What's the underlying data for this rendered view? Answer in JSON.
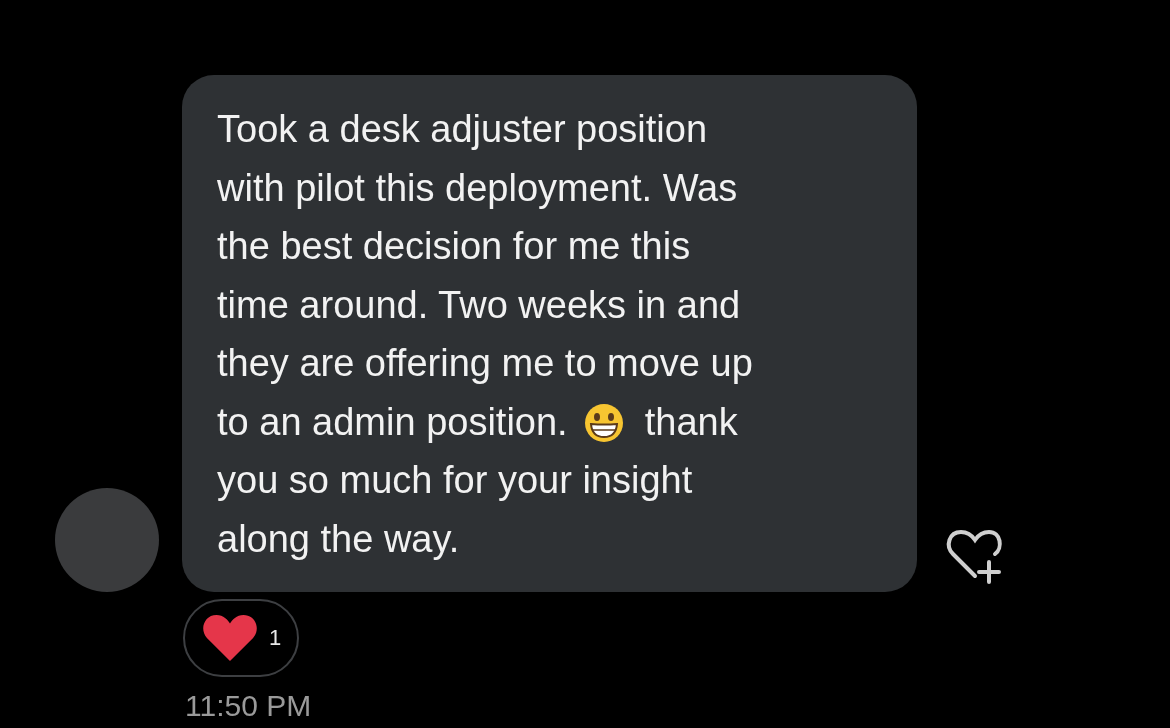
{
  "message": {
    "lines": [
      {
        "kind": "text",
        "text": "Took a desk adjuster position"
      },
      {
        "kind": "text",
        "text": "with pilot this deployment. Was"
      },
      {
        "kind": "text",
        "text": "the best decision for me this"
      },
      {
        "kind": "text",
        "text": "time around. Two weeks in and"
      },
      {
        "kind": "text",
        "text": "they are offering me to move up"
      },
      {
        "kind": "emoji",
        "before": "to an admin position.",
        "after": "thank"
      },
      {
        "kind": "text",
        "text": "you so much for your insight"
      },
      {
        "kind": "text",
        "text": "along the way."
      }
    ]
  },
  "reaction": {
    "count": "1"
  },
  "timestamp": "11:50 PM"
}
